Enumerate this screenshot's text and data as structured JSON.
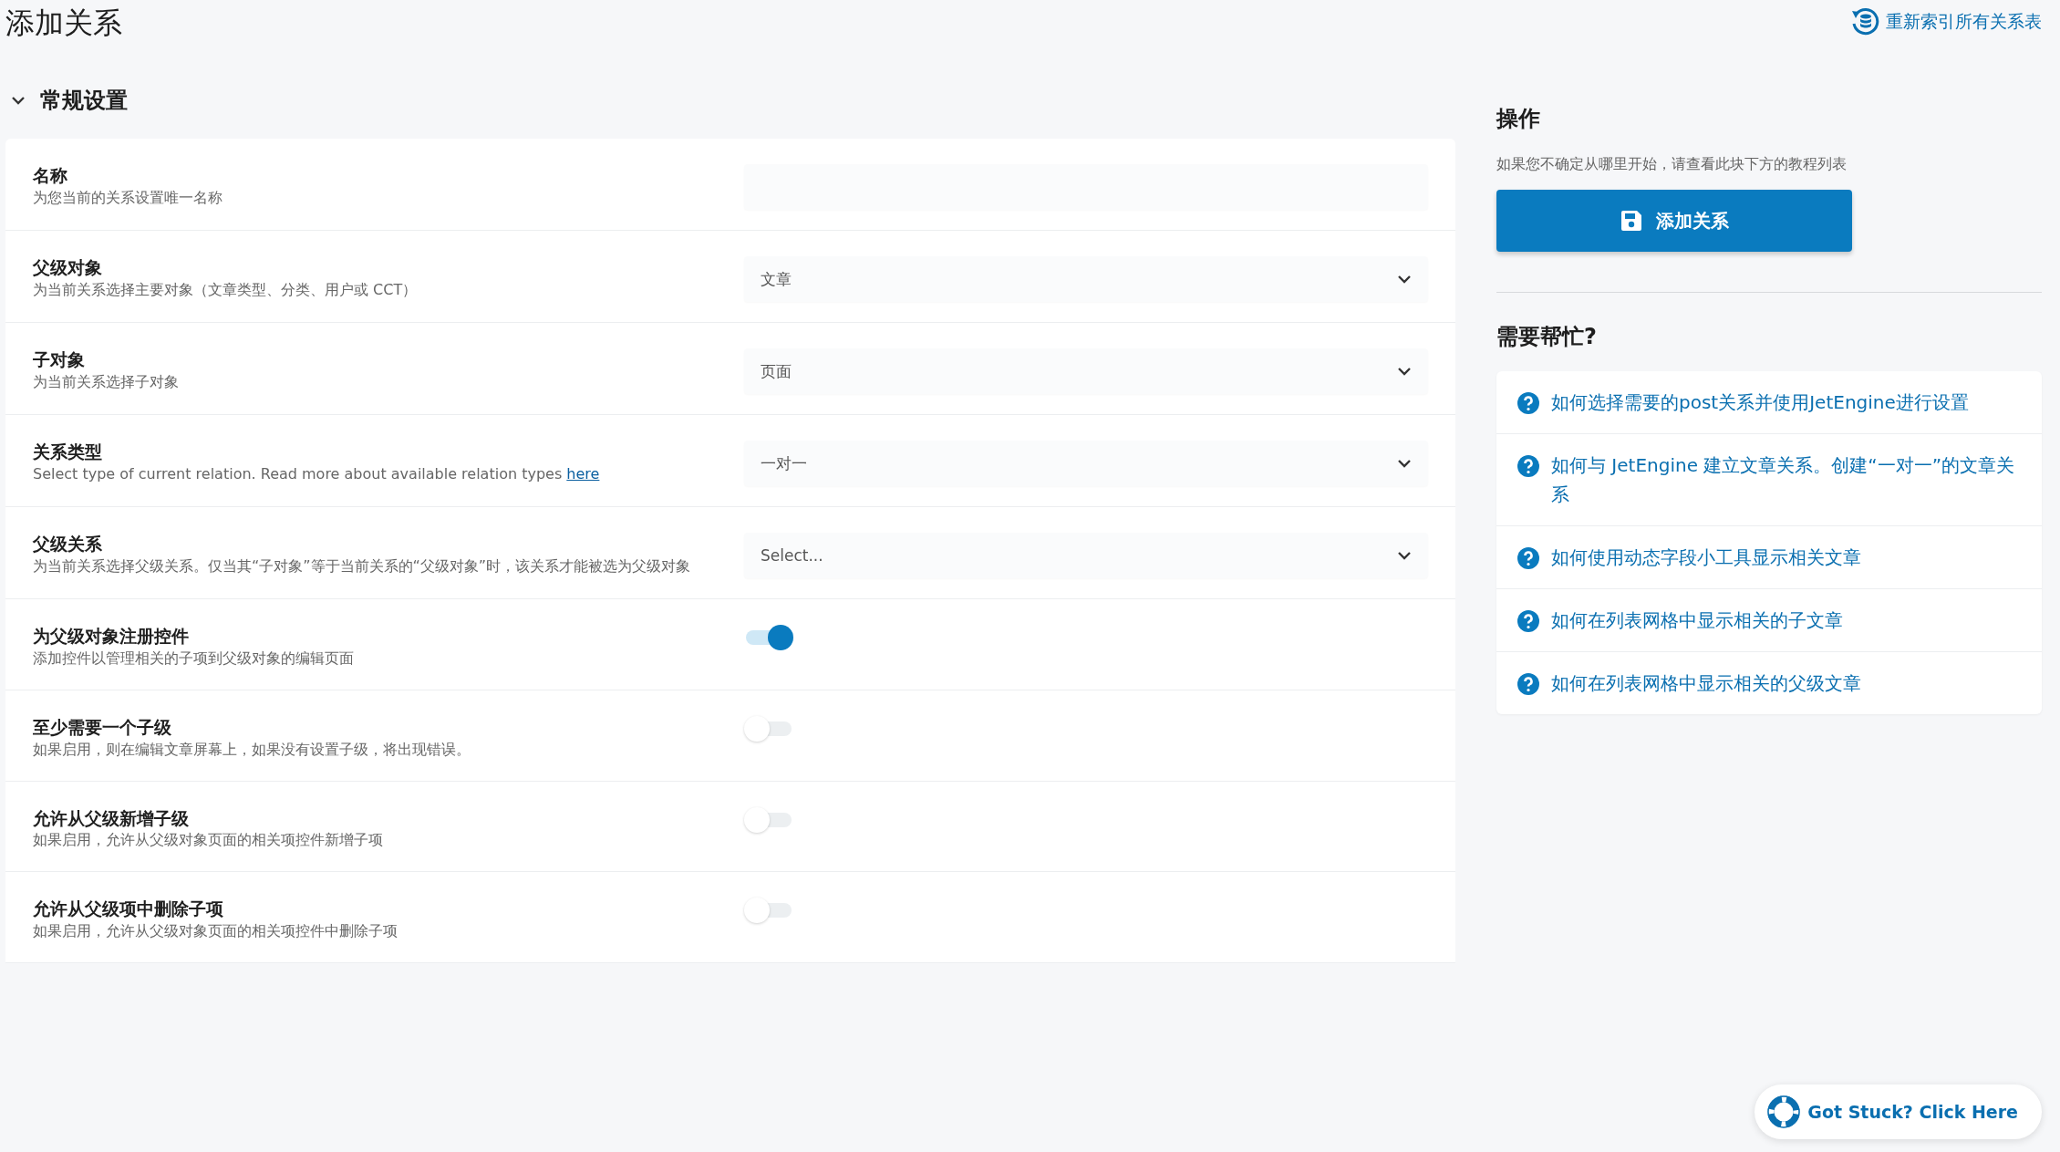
{
  "page_title": "添加关系",
  "reindex_link": "重新索引所有关系表",
  "section": {
    "title": "常规设置",
    "expanded": true,
    "fields": [
      {
        "kind": "text",
        "label": "名称",
        "description": "为您当前的关系设置唯一名称"
      },
      {
        "kind": "select",
        "label": "父级对象",
        "description": "为当前关系选择主要对象（文章类型、分类、用户或 CCT）",
        "value": "文章"
      },
      {
        "kind": "select",
        "label": "子对象",
        "description": "为当前关系选择子对象",
        "value": "页面"
      },
      {
        "kind": "select",
        "label": "关系类型",
        "description": "Select type of current relation. Read more about available relation types",
        "link": "here",
        "value": "一对一"
      },
      {
        "kind": "select",
        "label": "父级关系",
        "description": "为当前关系选择父级关系。仅当其“子对象”等于当前关系的“父级对象”时，该关系才能被选为父级对象",
        "placeholder": "Select..."
      },
      {
        "kind": "toggle",
        "label": "为父级对象注册控件",
        "description": "添加控件以管理相关的子项到父级对象的编辑页面",
        "on": true
      },
      {
        "kind": "toggle",
        "label": "至少需要一个子级",
        "description": "如果启用，则在编辑文章屏幕上，如果没有设置子级，将出现错误。",
        "on": false
      },
      {
        "kind": "toggle",
        "label": "允许从父级新增子级",
        "description": "如果启用，允许从父级对象页面的相关项控件新增子项",
        "on": false
      },
      {
        "kind": "toggle",
        "label": "允许从父级项中删除子项",
        "description": "如果启用，允许从父级对象页面的相关项控件中删除子项",
        "on": false
      }
    ]
  },
  "actions": {
    "title": "操作",
    "description": "如果您不确定从哪里开始，请查看此块下方的教程列表",
    "button": "添加关系"
  },
  "help": {
    "title": "需要帮忙?",
    "items": [
      "如何选择需要的post关系并使用JetEngine进行设置",
      "如何与 JetEngine 建立文章关系。创建“一对一”的文章关系",
      "如何使用动态字段小工具显示相关文章",
      "如何在列表网格中显示相关的子文章",
      "如何在列表网格中显示相关的父级文章"
    ]
  },
  "stuck_button": "Got Stuck? Click Here"
}
